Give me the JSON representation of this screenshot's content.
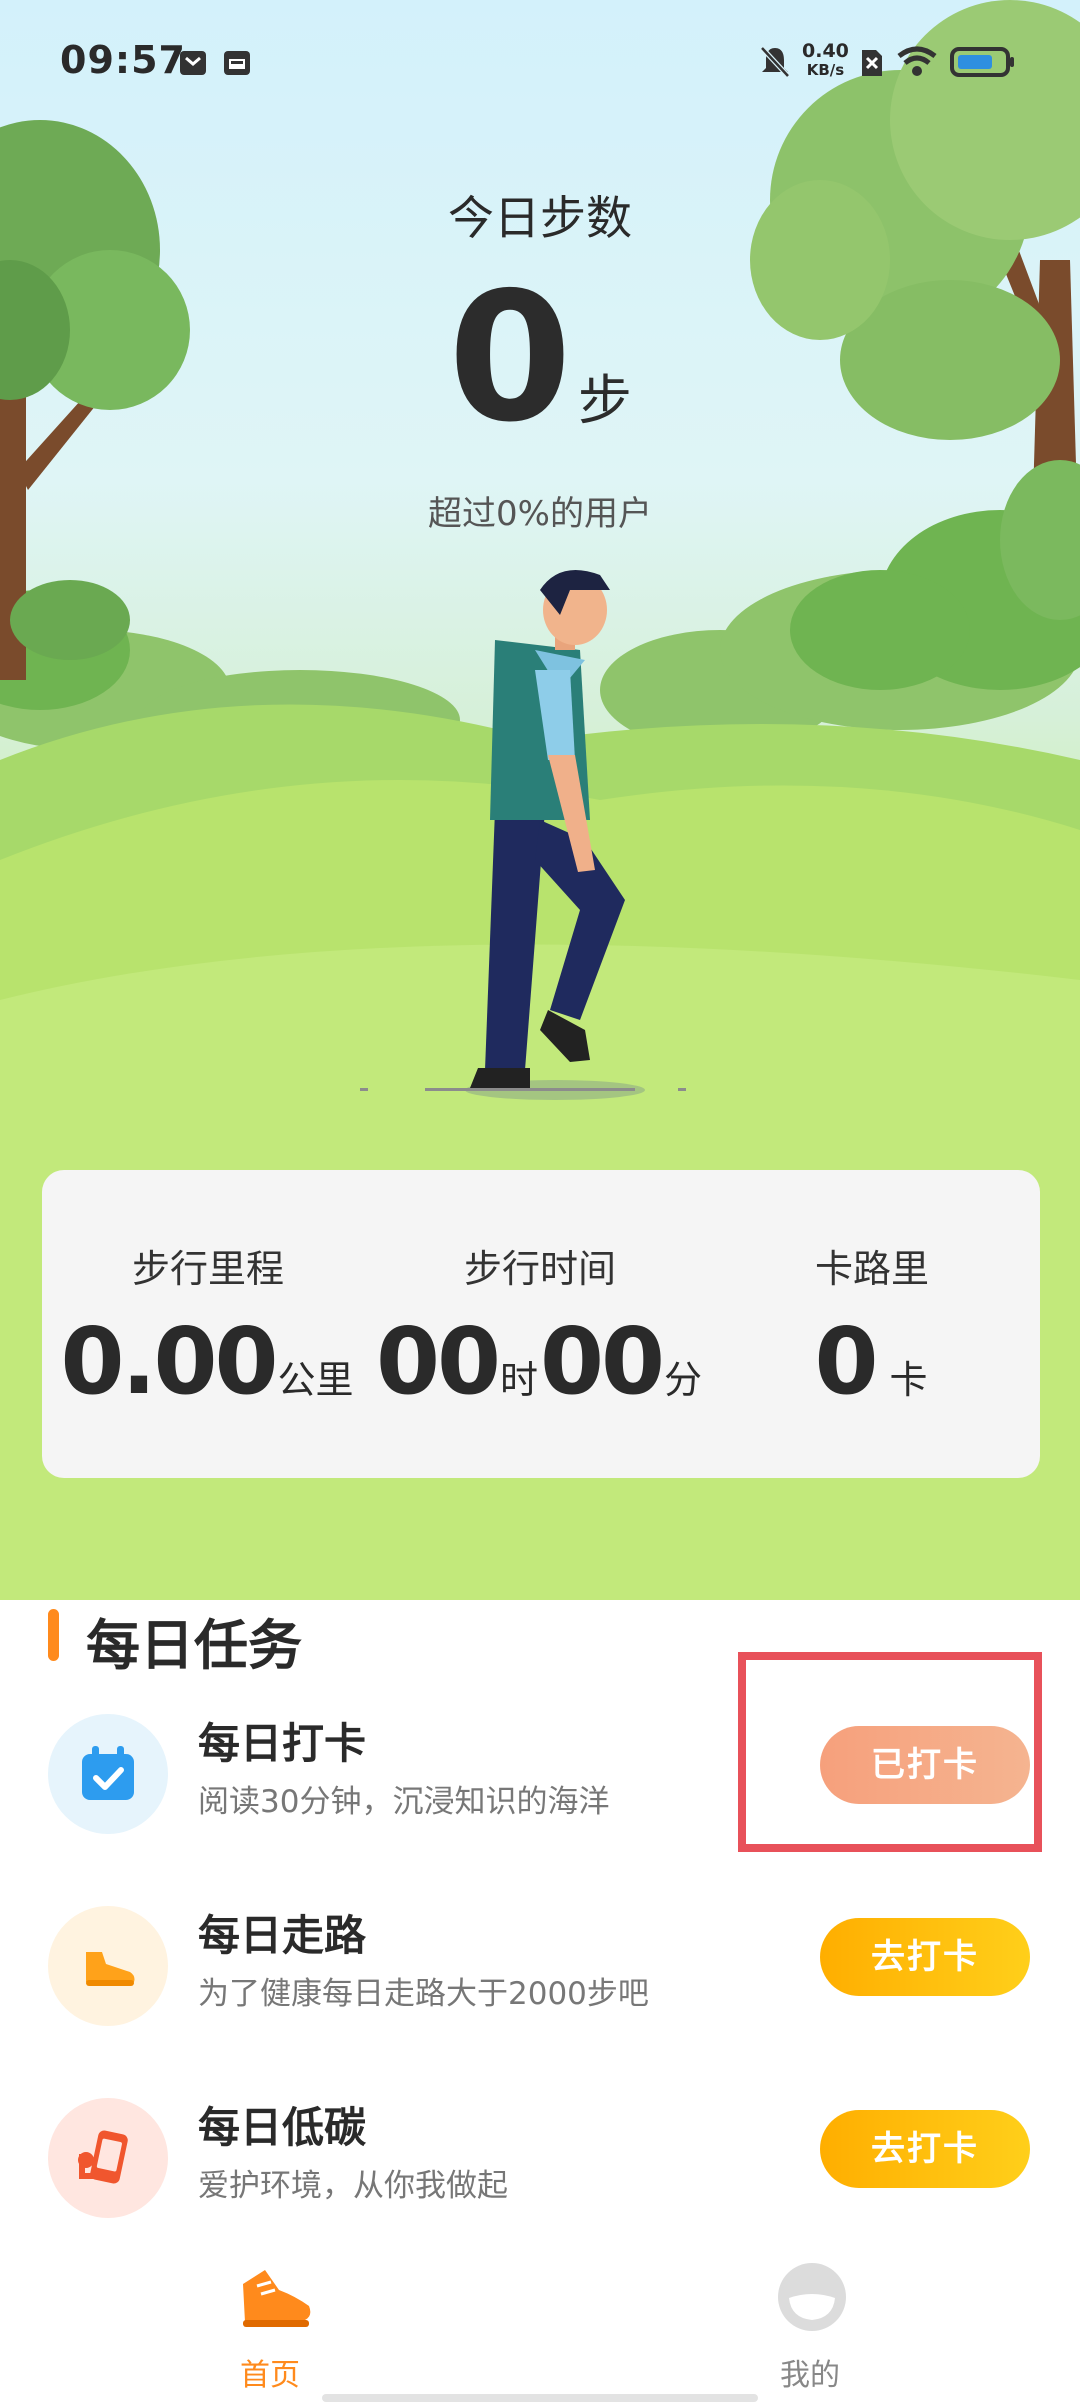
{
  "status_bar": {
    "time": "09:57",
    "net_speed_value": "0.40",
    "net_speed_unit": "KB/s",
    "icons": [
      "message-icon",
      "calendar-icon",
      "mute-icon",
      "sim-icon",
      "wifi-icon",
      "battery-icon"
    ]
  },
  "steps": {
    "title": "今日步数",
    "count": "0",
    "unit": "步",
    "subtitle": "超过0%的用户"
  },
  "stats": {
    "distance": {
      "label": "步行里程",
      "value": "0.00",
      "unit": "公里"
    },
    "time": {
      "label": "步行时间",
      "hours": "00",
      "hours_unit": "时",
      "minutes": "00",
      "minutes_unit": "分"
    },
    "calories": {
      "label": "卡路里",
      "value": "0",
      "unit": "卡"
    }
  },
  "tasks": {
    "header": "每日任务",
    "items": [
      {
        "name": "每日打卡",
        "desc": "阅读30分钟，沉浸知识的海洋",
        "button": "已打卡",
        "icon": "calendar-check-icon"
      },
      {
        "name": "每日走路",
        "desc": "为了健康每日走路大于2000步吧",
        "button": "去打卡",
        "icon": "shoe-icon"
      },
      {
        "name": "每日低碳",
        "desc": "爱护环境，从你我做起",
        "button": "去打卡",
        "icon": "phone-icon"
      }
    ]
  },
  "nav": {
    "home": "首页",
    "mine": "我的"
  },
  "colors": {
    "accent_orange": "#ff8a1c",
    "done_button": "#f6a07c",
    "go_button": "#ffbb0d",
    "highlight_box": "#e8515a"
  }
}
